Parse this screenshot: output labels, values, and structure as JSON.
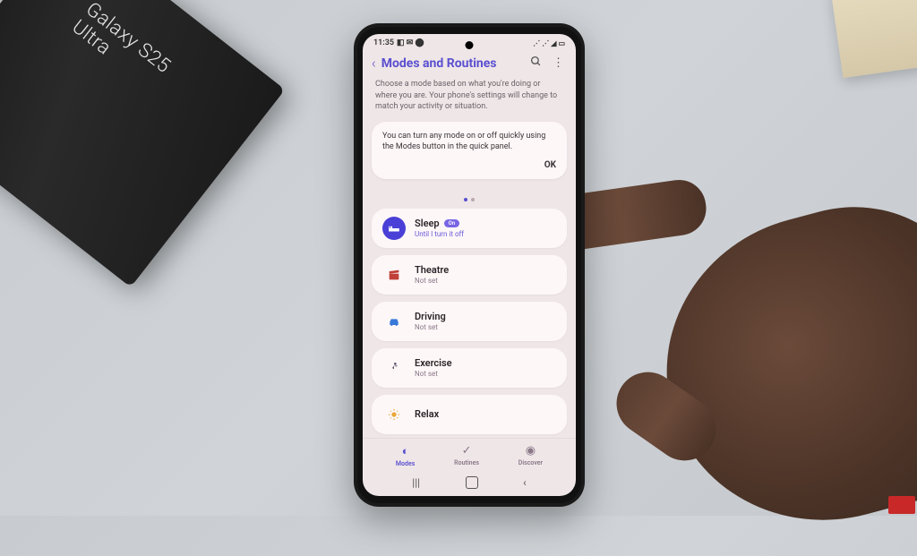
{
  "box_label": "Galaxy S25 Ultra",
  "status": {
    "time": "11:35",
    "battery_icon": "battery"
  },
  "header": {
    "title": "Modes and Routines"
  },
  "subtitle": "Choose a mode based on what you're doing or where you are. Your phone's settings will change to match your activity or situation.",
  "tip": {
    "text": "You can turn any mode on or off quickly using the Modes button in the quick panel.",
    "ok": "OK"
  },
  "modes": [
    {
      "name": "Sleep",
      "sub": "Until I turn it off",
      "badge": "On",
      "icon": "bed",
      "active": true
    },
    {
      "name": "Theatre",
      "sub": "Not set",
      "badge": "",
      "icon": "clapper",
      "active": false
    },
    {
      "name": "Driving",
      "sub": "Not set",
      "badge": "",
      "icon": "car",
      "active": false
    },
    {
      "name": "Exercise",
      "sub": "Not set",
      "badge": "",
      "icon": "run",
      "active": false
    },
    {
      "name": "Relax",
      "sub": "",
      "badge": "",
      "icon": "sun",
      "active": false
    }
  ],
  "nav": {
    "modes": "Modes",
    "routines": "Routines",
    "discover": "Discover"
  }
}
